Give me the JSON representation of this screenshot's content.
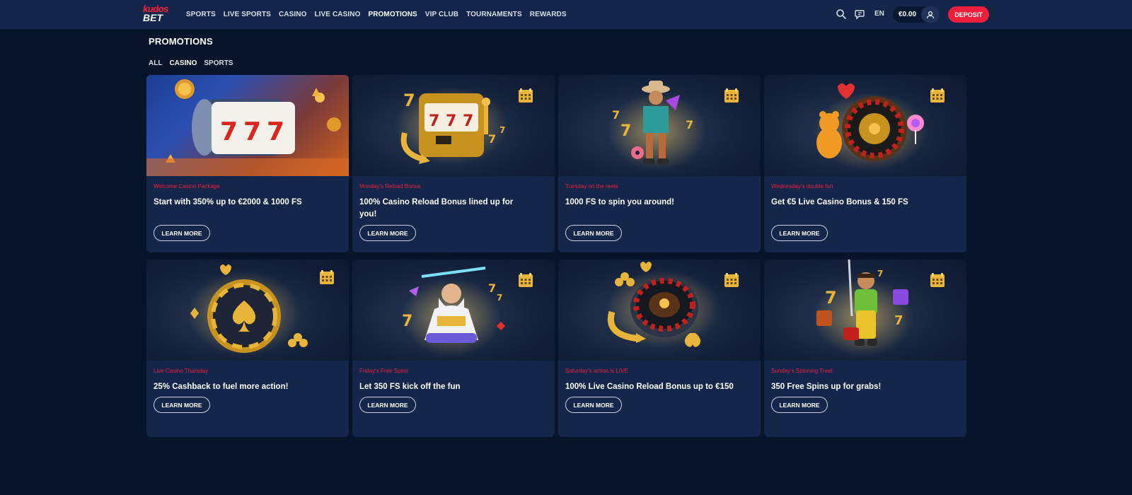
{
  "header": {
    "logo_top": "kudos",
    "logo_bottom": "BET",
    "nav": [
      {
        "label": "SPORTS"
      },
      {
        "label": "LIVE SPORTS"
      },
      {
        "label": "CASINO"
      },
      {
        "label": "LIVE CASINO"
      },
      {
        "label": "PROMOTIONS",
        "active": true
      },
      {
        "label": "VIP CLUB"
      },
      {
        "label": "TOURNAMENTS"
      },
      {
        "label": "REWARDS"
      }
    ],
    "language": "EN",
    "balance": "€0.00",
    "deposit_label": "DEPOSIT"
  },
  "page": {
    "title": "PROMOTIONS",
    "filters": [
      {
        "label": "ALL"
      },
      {
        "label": "CASINO",
        "active": true
      },
      {
        "label": "SPORTS"
      }
    ]
  },
  "promotions": [
    {
      "tag": "Welcome Casino Package",
      "title": "Start with 350% up to €2000 & 1000 FS",
      "button": "LEARN MORE",
      "icon": "slot-reel-777"
    },
    {
      "tag": "Monday's Reload Bonus",
      "title": "100% Casino Reload Bonus lined up for you!",
      "button": "LEARN MORE",
      "icon": "slot-machine"
    },
    {
      "tag": "Tuesday on the reels",
      "title": "1000 FS to spin you around!",
      "button": "LEARN MORE",
      "icon": "cowboy-character"
    },
    {
      "tag": "Wednesday's double fun",
      "title": "Get €5 Live Casino Bonus & 150 FS",
      "button": "LEARN MORE",
      "icon": "roulette-bear"
    },
    {
      "tag": "Live Casino Thursday",
      "title": "25% Cashback to fuel more action!",
      "button": "LEARN MORE",
      "icon": "poker-chip"
    },
    {
      "tag": "Friday's Free Spins",
      "title": "Let 350 FS kick off the fun",
      "button": "LEARN MORE",
      "icon": "zeus-character"
    },
    {
      "tag": "Saturday's action is LIVE",
      "title": "100% Live Casino Reload Bonus up to €150",
      "button": "LEARN MORE",
      "icon": "roulette-wheel"
    },
    {
      "tag": "Sunday's Spinning Treat",
      "title": "350 Free Spins up for grabs!",
      "button": "LEARN MORE",
      "icon": "miner-character"
    }
  ],
  "colors": {
    "accent": "#ee1e3c",
    "header_bg": "#14274a",
    "page_bg": "#08142a",
    "card_bg": "#14264a",
    "gold": "#e9b43a"
  }
}
